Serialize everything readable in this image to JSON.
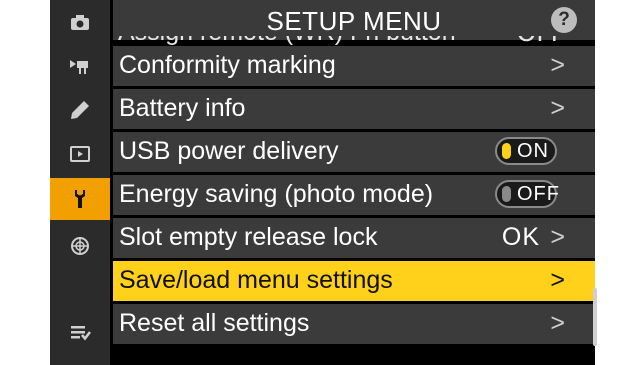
{
  "header": {
    "title": "SETUP MENU",
    "help": "?"
  },
  "sidebar": {
    "items": [
      {
        "icon": "camera-icon",
        "active": false
      },
      {
        "icon": "movie-camera-icon",
        "active": false
      },
      {
        "icon": "pencil-icon",
        "active": false
      },
      {
        "icon": "playback-icon",
        "active": false
      },
      {
        "icon": "wrench-icon",
        "active": true
      },
      {
        "icon": "network-icon",
        "active": false
      },
      {
        "icon": "my-menu-icon",
        "active": false
      }
    ]
  },
  "clipped_row": {
    "label": "Assign remote (WR) Fn button",
    "value": "OFF"
  },
  "menu": {
    "items": [
      {
        "label": "Conformity marking",
        "chevron": ">"
      },
      {
        "label": "Battery info",
        "chevron": ">"
      },
      {
        "label": "USB power delivery",
        "toggle": "ON"
      },
      {
        "label": "Energy saving (photo mode)",
        "toggle": "OFF"
      },
      {
        "label": "Slot empty release lock",
        "value": "OK",
        "chevron": ">"
      },
      {
        "label": "Save/load menu settings",
        "chevron": ">",
        "selected": true
      },
      {
        "label": "Reset all settings",
        "chevron": ">"
      }
    ]
  },
  "colors": {
    "accent": "#ffd11a",
    "active_tab": "#f2a000",
    "row_bg": "#3b3b3b"
  }
}
